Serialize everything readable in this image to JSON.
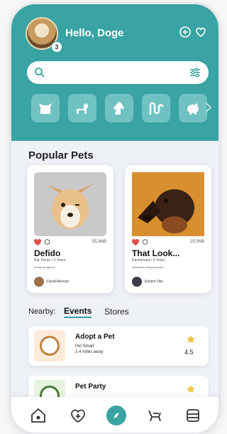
{
  "header": {
    "greeting": "Hello, Doge",
    "avatar_badge": "3",
    "icons": [
      "add-circle-icon",
      "heart-outline-icon"
    ]
  },
  "search": {
    "placeholder": "",
    "icons": [
      "search-icon",
      "filter-sliders-icon"
    ]
  },
  "categories": [
    "cat-icon",
    "dog-icon",
    "horse-icon",
    "snake-icon",
    "pig-icon"
  ],
  "popular": {
    "title": "Popular Pets",
    "pets": [
      {
        "name": "Defido",
        "subtitle": "Rat Terrier • 2 Years",
        "tags": "#relay #doglover",
        "stats": "55.8NB",
        "owner": "David Merrow"
      },
      {
        "name": "That Look...",
        "subtitle": "Dachshund • 4 Years",
        "tags": "#hellmany #doyouwanna",
        "stats": "25.0NB",
        "owner": "Kristen Otis"
      }
    ]
  },
  "nearby": {
    "label": "Nearby:",
    "tabs": [
      "Events",
      "Stores"
    ]
  },
  "events": [
    {
      "title": "Adopt a Pet",
      "place": "Pet Smart",
      "distance": "3.4 miles away",
      "rating": "4.5"
    },
    {
      "title": "Pet Party",
      "place": "",
      "distance": "",
      "rating": ""
    }
  ],
  "bottom_nav": [
    "home-icon",
    "heart-plus-icon",
    "compass-icon",
    "pet-stroller-icon",
    "storage-icon"
  ],
  "colors": {
    "teal": "#3aa3a3",
    "teal_light": "#70c2c2",
    "background": "#eef1f6",
    "heart": "#e14a4a",
    "star": "#f4c542"
  }
}
